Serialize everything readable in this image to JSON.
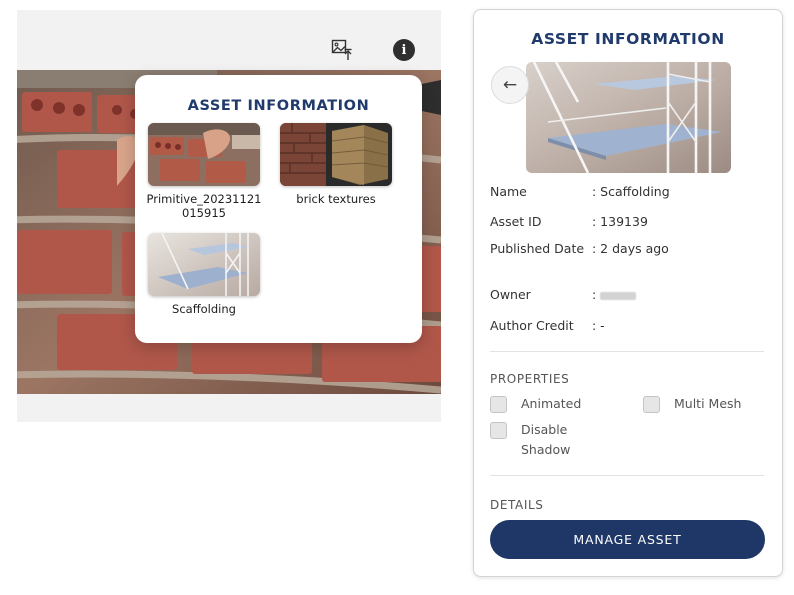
{
  "popup": {
    "title": "ASSET INFORMATION",
    "items": [
      {
        "label": "Primitive_20231121015915"
      },
      {
        "label": "brick textures"
      },
      {
        "label": "Scaffolding"
      }
    ]
  },
  "panel": {
    "title": "ASSET INFORMATION",
    "back_symbol": "←",
    "fields": {
      "name": {
        "label": "Name",
        "value": ": Scaffolding"
      },
      "asset_id": {
        "label": "Asset ID",
        "value": ": 139139"
      },
      "published": {
        "label": "Published Date",
        "value": ": 2 days ago"
      },
      "owner": {
        "label": "Owner",
        "value": ":"
      },
      "credit": {
        "label": "Author Credit",
        "value": ": -"
      }
    },
    "properties_label": "PROPERTIES",
    "properties": {
      "animated": "Animated",
      "multi_mesh": "Multi Mesh",
      "disable_shadow": "Disable Shadow"
    },
    "details_label": "DETAILS",
    "manage_label": "MANAGE ASSET"
  },
  "toolbar": {
    "info_glyph": "i",
    "icons": [
      "image-upload-icon",
      "info-icon"
    ]
  },
  "colors": {
    "accent_title": "#203a6b",
    "button": "#1e3766",
    "viewer_bg": "#f2f2f2"
  }
}
